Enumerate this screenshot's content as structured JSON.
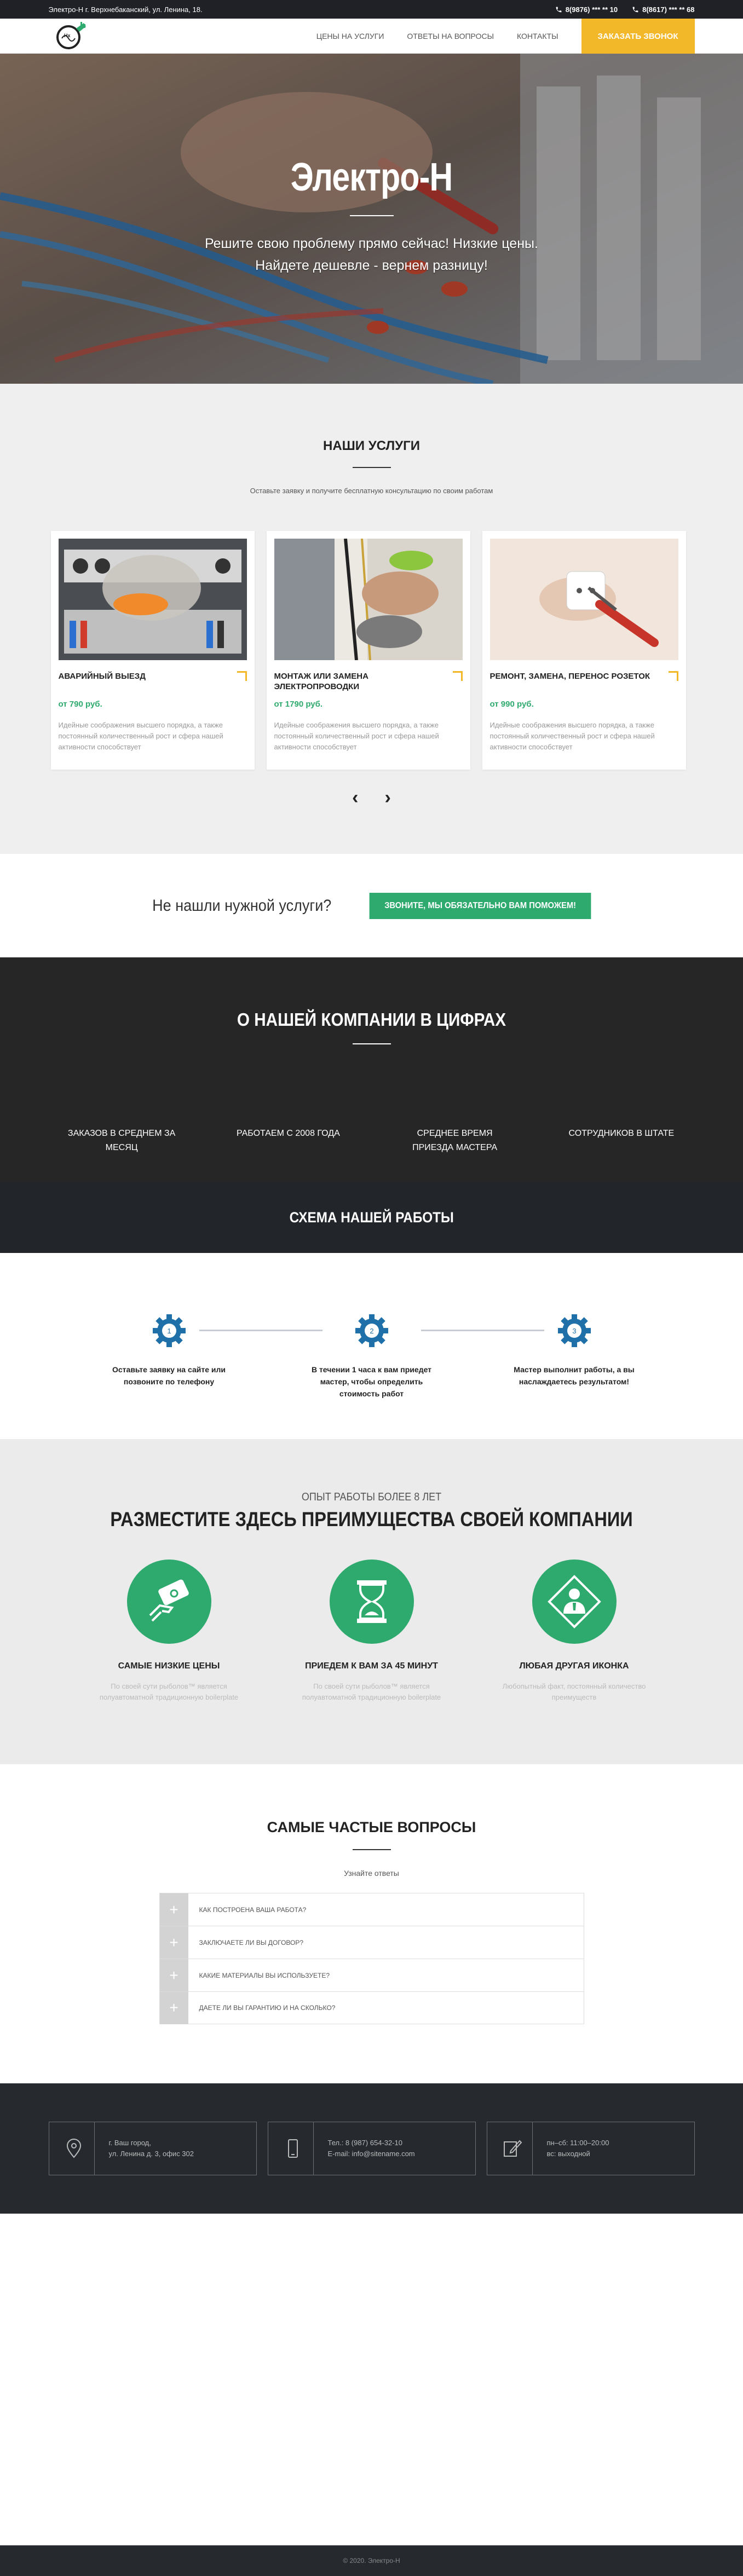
{
  "topbar": {
    "address": "Электро-Н г. Верхнебаканский, ул. Ленина, 18.",
    "phone1": "8(9876) *** ** 10",
    "phone2": "8(8617) *** ** 68"
  },
  "header": {
    "nav": [
      "ЦЕНЫ НА УСЛУГИ",
      "ОТВЕТЫ НА ВОПРОСЫ",
      "КОНТАКТЫ"
    ],
    "cta": "ЗАКАЗАТЬ ЗВОНОК"
  },
  "hero": {
    "title": "Электро-Н",
    "line1": "Решите свою проблему прямо сейчас! Низкие цены.",
    "line2": "Найдете дешевле - вернем разницу!"
  },
  "services": {
    "title": "НАШИ УСЛУГИ",
    "subtitle": "Оставьте заявку и получите бесплатную консультацию по своим работам",
    "cards": [
      {
        "title": "АВАРИЙНЫЙ ВЫЕЗД",
        "price": "от 790 руб.",
        "desc": "Идейные соображения высшего порядка, а также постоянный количественный рост и сфера нашей активности способствует"
      },
      {
        "title": "МОНТАЖ ИЛИ ЗАМЕНА ЭЛЕКТРОПРОВОДКИ",
        "price": "от 1790 руб.",
        "desc": "Идейные соображения высшего порядка, а также постоянный количественный рост и сфера нашей активности способствует"
      },
      {
        "title": "РЕМОНТ, ЗАМЕНА, ПЕРЕНОС РОЗЕТОК",
        "price": "от 990 руб.",
        "desc": "Идейные соображения высшего порядка, а также постоянный количественный рост и сфера нашей активности способствует"
      }
    ],
    "prev": "‹",
    "next": "›"
  },
  "cta": {
    "question": "Не нашли нужной услуги?",
    "button": "ЗВОНИТЕ, МЫ ОБЯЗАТЕЛЬНО ВАМ ПОМОЖЕМ!"
  },
  "stats": {
    "title": "О НАШЕЙ КОМПАНИИ В ЦИФРАХ",
    "items": [
      "ЗАКАЗОВ В СРЕДНЕМ ЗА МЕСЯЦ",
      "РАБОТАЕМ С 2008 ГОДА",
      "СРЕДНЕЕ ВРЕМЯ ПРИЕЗДА МАСТЕРА",
      "СОТРУДНИКОВ В ШТАТЕ"
    ]
  },
  "scheme": {
    "title": "СХЕМА НАШЕЙ РАБОТЫ",
    "steps": [
      {
        "num": "1",
        "text": "Оставьте заявку на сайте или позвоните по телефону"
      },
      {
        "num": "2",
        "text": "В течении 1 часа к вам приедет мастер, чтобы определить стоимость работ"
      },
      {
        "num": "3",
        "text": "Мастер выполнит работы, а вы наслаждаетесь результатом!"
      }
    ]
  },
  "advantages": {
    "kicker": "ОПЫТ РАБОТЫ БОЛЕЕ 8 ЛЕТ",
    "title": "РАЗМЕСТИТЕ ЗДЕСЬ ПРЕИМУЩЕСТВА СВОЕЙ КОМПАНИИ",
    "items": [
      {
        "title": "САМЫЕ НИЗКИЕ ЦЕНЫ",
        "desc": "По своей сути рыболов™ является полуавтоматной традиционную boilerplate"
      },
      {
        "title": "ПРИЕДЕМ К ВАМ ЗА 45 МИНУТ",
        "desc": "По своей сути рыболов™ является полуавтоматной традиционную boilerplate"
      },
      {
        "title": "ЛЮБАЯ ДРУГАЯ ИКОНКА",
        "desc": "Любопытный факт, постоянный количество преимуществ"
      }
    ]
  },
  "faq": {
    "title": "САМЫЕ ЧАСТЫЕ ВОПРОСЫ",
    "subtitle": "Узнайте ответы",
    "items": [
      "КАК ПОСТРОЕНА ВАША РАБОТА?",
      "ЗАКЛЮЧАЕТЕ ЛИ ВЫ ДОГОВОР?",
      "КАКИЕ МАТЕРИАЛЫ ВЫ ИСПОЛЬЗУЕТЕ?",
      "ДАЕТЕ ЛИ ВЫ ГАРАНТИЮ И НА СКОЛЬКО?"
    ]
  },
  "contacts": {
    "address1": "г. Ваш город,",
    "address2": "ул. Ленина д. 3, офис 302",
    "tel": "Тел.: 8 (987) 654-32-10",
    "email": "E-mail: info@sitename.com",
    "hours1": "пн–сб: 11:00–20:00",
    "hours2": "вс: выходной"
  },
  "footer": {
    "copy": "© 2020. Электро-Н"
  },
  "colors": {
    "accent_yellow": "#f3b829",
    "green": "#2eaa6e",
    "blue_gear": "#1f6fa8",
    "dark": "#262626"
  }
}
